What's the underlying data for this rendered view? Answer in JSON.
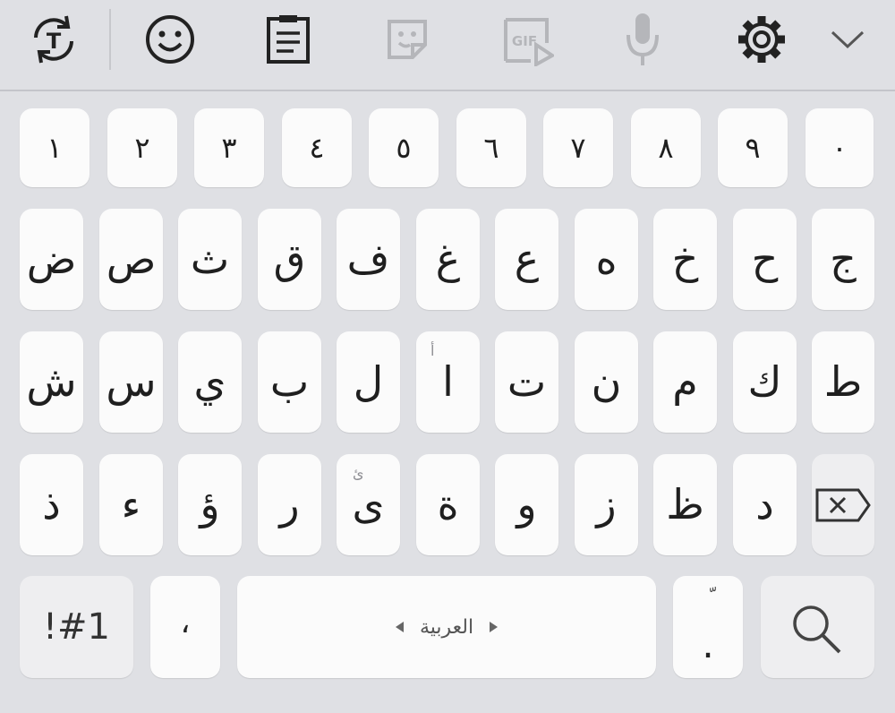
{
  "toolbar": {
    "items": [
      {
        "icon": "text-translate-icon",
        "enabled": true
      },
      {
        "icon": "emoji-icon",
        "enabled": true
      },
      {
        "icon": "clipboard-icon",
        "enabled": true
      },
      {
        "icon": "sticker-icon",
        "enabled": false
      },
      {
        "icon": "gif-icon",
        "label": "GIF",
        "enabled": false
      },
      {
        "icon": "microphone-icon",
        "enabled": false
      },
      {
        "icon": "settings-gear-icon",
        "enabled": true
      },
      {
        "icon": "chevron-down-icon",
        "enabled": true
      }
    ]
  },
  "keyboard": {
    "number_row": [
      "١",
      "٢",
      "٣",
      "٤",
      "٥",
      "٦",
      "٧",
      "٨",
      "٩",
      "٠"
    ],
    "row1": [
      {
        "char": "ض"
      },
      {
        "char": "ص"
      },
      {
        "char": "ث"
      },
      {
        "char": "ق"
      },
      {
        "char": "ف"
      },
      {
        "char": "غ"
      },
      {
        "char": "ع"
      },
      {
        "char": "ه"
      },
      {
        "char": "خ"
      },
      {
        "char": "ح"
      },
      {
        "char": "ج"
      }
    ],
    "row2": [
      {
        "char": "ش"
      },
      {
        "char": "س"
      },
      {
        "char": "ي"
      },
      {
        "char": "ب"
      },
      {
        "char": "ل"
      },
      {
        "char": "ا",
        "alt": "أ"
      },
      {
        "char": "ت"
      },
      {
        "char": "ن"
      },
      {
        "char": "م"
      },
      {
        "char": "ك"
      },
      {
        "char": "ط"
      }
    ],
    "row3": [
      {
        "char": "ذ"
      },
      {
        "char": "ء"
      },
      {
        "char": "ؤ"
      },
      {
        "char": "ر"
      },
      {
        "char": "ى",
        "alt": "ئ"
      },
      {
        "char": "ة"
      },
      {
        "char": "و"
      },
      {
        "char": "ز"
      },
      {
        "char": "ظ"
      },
      {
        "char": "د"
      }
    ],
    "bottom": {
      "symbols_label": "!#1",
      "comma": "،",
      "space_label": "العربية",
      "period": ".",
      "period_alt": "ّ"
    }
  },
  "colors": {
    "background": "#dfe0e4",
    "key": "#fbfbfb",
    "function_key": "#eeeef0",
    "disabled_icon": "#b5b6ba",
    "icon": "#222222"
  }
}
